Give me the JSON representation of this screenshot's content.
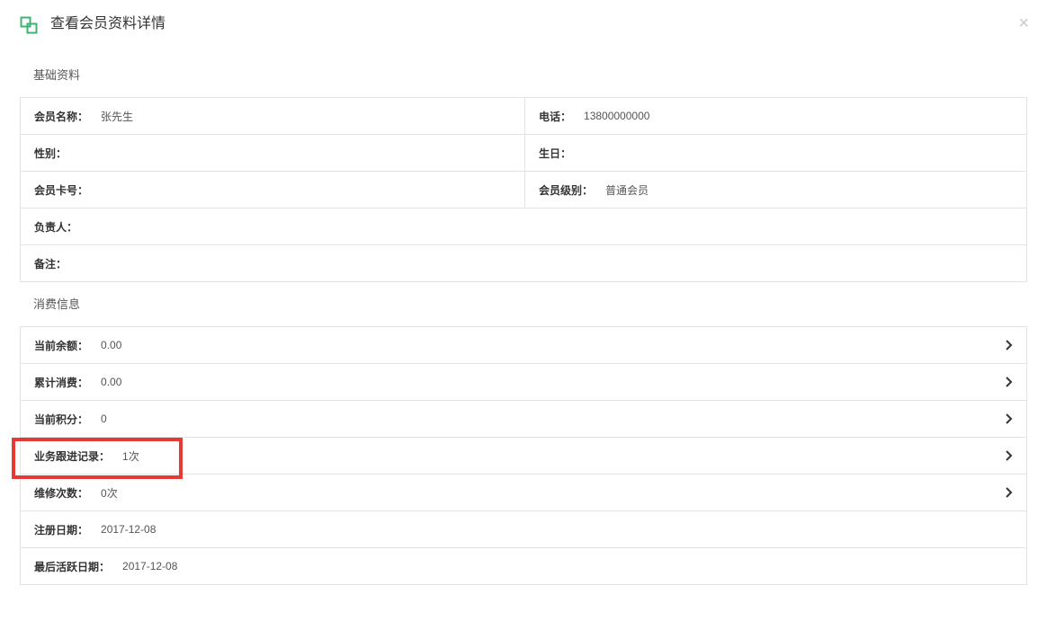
{
  "header": {
    "title": "查看会员资料详情",
    "close_symbol": "×",
    "icon": "copy-window-icon",
    "accent_color": "#3cb371"
  },
  "basic": {
    "section_title": "基础资料",
    "name_label": "会员名称：",
    "name_value": "张先生",
    "phone_label": "电话：",
    "phone_value": "13800000000",
    "gender_label": "性别：",
    "gender_value": "",
    "birthday_label": "生日：",
    "birthday_value": "",
    "card_label": "会员卡号：",
    "card_value": "",
    "level_label": "会员级别：",
    "level_value": "普通会员",
    "manager_label": "负责人：",
    "manager_value": "",
    "remark_label": "备注：",
    "remark_value": ""
  },
  "consume": {
    "section_title": "消费信息",
    "rows": [
      {
        "label": "当前余额：",
        "value": "0.00"
      },
      {
        "label": "累计消费：",
        "value": "0.00"
      },
      {
        "label": "当前积分：",
        "value": "0"
      },
      {
        "label": "业务跟进记录：",
        "value": "1次"
      },
      {
        "label": "维修次数：",
        "value": "0次"
      },
      {
        "label": "注册日期：",
        "value": "2017-12-08"
      },
      {
        "label": "最后活跃日期：",
        "value": "2017-12-08"
      }
    ]
  },
  "highlight_color": "#e53935"
}
